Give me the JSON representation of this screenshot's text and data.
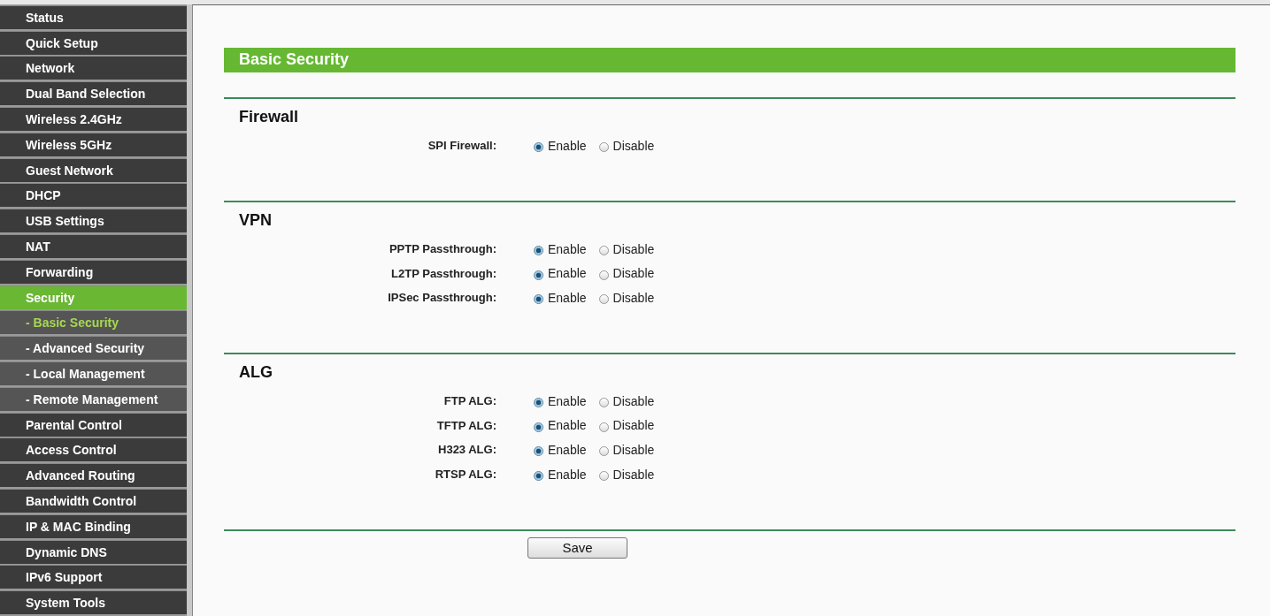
{
  "sidebar": {
    "items": [
      {
        "label": "Status",
        "kind": "main",
        "selected": false
      },
      {
        "label": "Quick Setup",
        "kind": "main",
        "selected": false
      },
      {
        "label": "Network",
        "kind": "main",
        "selected": false
      },
      {
        "label": "Dual Band Selection",
        "kind": "main",
        "selected": false
      },
      {
        "label": "Wireless 2.4GHz",
        "kind": "main",
        "selected": false
      },
      {
        "label": "Wireless 5GHz",
        "kind": "main",
        "selected": false
      },
      {
        "label": "Guest Network",
        "kind": "main",
        "selected": false
      },
      {
        "label": "DHCP",
        "kind": "main",
        "selected": false
      },
      {
        "label": "USB Settings",
        "kind": "main",
        "selected": false
      },
      {
        "label": "NAT",
        "kind": "main",
        "selected": false
      },
      {
        "label": "Forwarding",
        "kind": "main",
        "selected": false
      },
      {
        "label": "Security",
        "kind": "main",
        "selected": true
      },
      {
        "label": "- Basic Security",
        "kind": "sub",
        "selected": true
      },
      {
        "label": "- Advanced Security",
        "kind": "sub",
        "selected": false
      },
      {
        "label": "- Local Management",
        "kind": "sub",
        "selected": false
      },
      {
        "label": "- Remote Management",
        "kind": "sub",
        "selected": false
      },
      {
        "label": "Parental Control",
        "kind": "main",
        "selected": false
      },
      {
        "label": "Access Control",
        "kind": "main",
        "selected": false
      },
      {
        "label": "Advanced Routing",
        "kind": "main",
        "selected": false
      },
      {
        "label": "Bandwidth Control",
        "kind": "main",
        "selected": false
      },
      {
        "label": "IP & MAC Binding",
        "kind": "main",
        "selected": false
      },
      {
        "label": "Dynamic DNS",
        "kind": "main",
        "selected": false
      },
      {
        "label": "IPv6 Support",
        "kind": "main",
        "selected": false
      },
      {
        "label": "System Tools",
        "kind": "main",
        "selected": false
      }
    ]
  },
  "page_title": "Basic Security",
  "sections": [
    {
      "title": "Firewall",
      "rows": [
        {
          "label": "SPI Firewall:",
          "options": [
            {
              "label": "Enable",
              "selected": true
            },
            {
              "label": "Disable",
              "selected": false
            }
          ]
        }
      ]
    },
    {
      "title": "VPN",
      "rows": [
        {
          "label": "PPTP Passthrough:",
          "options": [
            {
              "label": "Enable",
              "selected": true
            },
            {
              "label": "Disable",
              "selected": false
            }
          ]
        },
        {
          "label": "L2TP Passthrough:",
          "options": [
            {
              "label": "Enable",
              "selected": true
            },
            {
              "label": "Disable",
              "selected": false
            }
          ]
        },
        {
          "label": "IPSec Passthrough:",
          "options": [
            {
              "label": "Enable",
              "selected": true
            },
            {
              "label": "Disable",
              "selected": false
            }
          ]
        }
      ]
    },
    {
      "title": "ALG",
      "rows": [
        {
          "label": "FTP ALG:",
          "options": [
            {
              "label": "Enable",
              "selected": true
            },
            {
              "label": "Disable",
              "selected": false
            }
          ]
        },
        {
          "label": "TFTP ALG:",
          "options": [
            {
              "label": "Enable",
              "selected": true
            },
            {
              "label": "Disable",
              "selected": false
            }
          ]
        },
        {
          "label": "H323 ALG:",
          "options": [
            {
              "label": "Enable",
              "selected": true
            },
            {
              "label": "Disable",
              "selected": false
            }
          ]
        },
        {
          "label": "RTSP ALG:",
          "options": [
            {
              "label": "Enable",
              "selected": true
            },
            {
              "label": "Disable",
              "selected": false
            }
          ]
        }
      ]
    }
  ],
  "save_button": "Save"
}
